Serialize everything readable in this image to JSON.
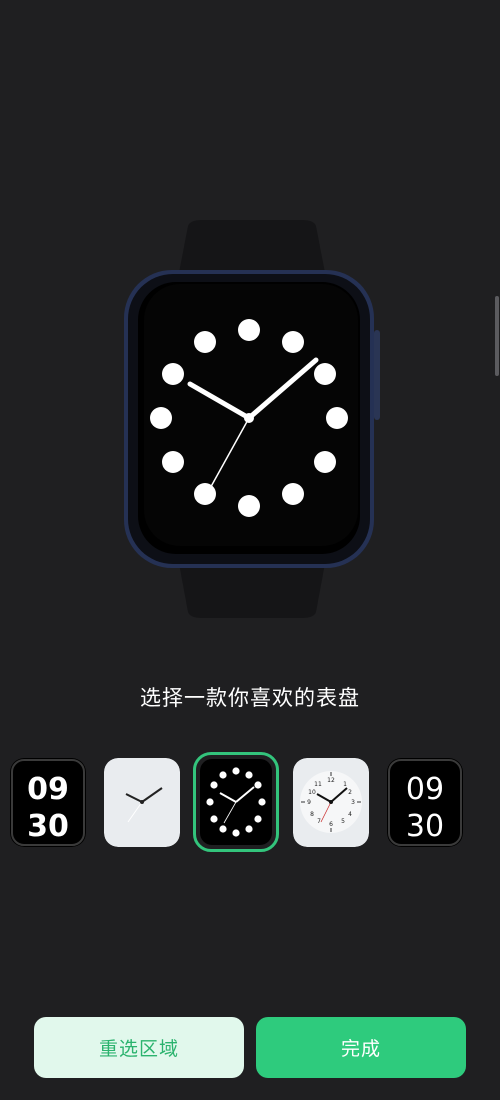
{
  "prompt": "选择一款你喜欢的表盘",
  "faces": [
    {
      "id": "digital-bold",
      "time_top": "09",
      "time_bottom": "30"
    },
    {
      "id": "minimal-white"
    },
    {
      "id": "dots-analog",
      "selected": true
    },
    {
      "id": "classic-numeric"
    },
    {
      "id": "digital-thin",
      "time_top": "09",
      "time_bottom": "30"
    }
  ],
  "buttons": {
    "reselect": "重选区域",
    "done": "完成"
  },
  "colors": {
    "background": "#1f1f21",
    "accent": "#2ecb7d",
    "accent_light": "#e1f8ec",
    "selected_border": "#33c47c"
  }
}
